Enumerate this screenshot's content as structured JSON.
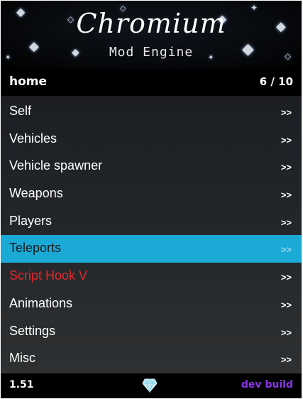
{
  "banner": {
    "title": "Chromium",
    "subtitle": "Mod Engine",
    "decoration_icon": "diamond-icon"
  },
  "subheader": {
    "title": "home",
    "counter": "6 / 10"
  },
  "items": [
    {
      "label": "Self",
      "arrow": ">>"
    },
    {
      "label": "Vehicles",
      "arrow": ">>"
    },
    {
      "label": "Vehicle spawner",
      "arrow": ">>"
    },
    {
      "label": "Weapons",
      "arrow": ">>"
    },
    {
      "label": "Players",
      "arrow": ">>"
    },
    {
      "label": "Teleports",
      "arrow": ">>",
      "selected": true
    },
    {
      "label": "Script Hook V",
      "arrow": ">>"
    },
    {
      "label": "Animations",
      "arrow": ">>"
    },
    {
      "label": "Settings",
      "arrow": ">>"
    },
    {
      "label": "Misc",
      "arrow": ">>"
    }
  ],
  "footer": {
    "version": "1.51",
    "build": "dev build",
    "icon": "diamond-icon"
  },
  "colors": {
    "selection": "#1ba9d6",
    "script_hook_label": "#e5262d",
    "build_label": "#8a35e8",
    "text": "#ffffff"
  }
}
